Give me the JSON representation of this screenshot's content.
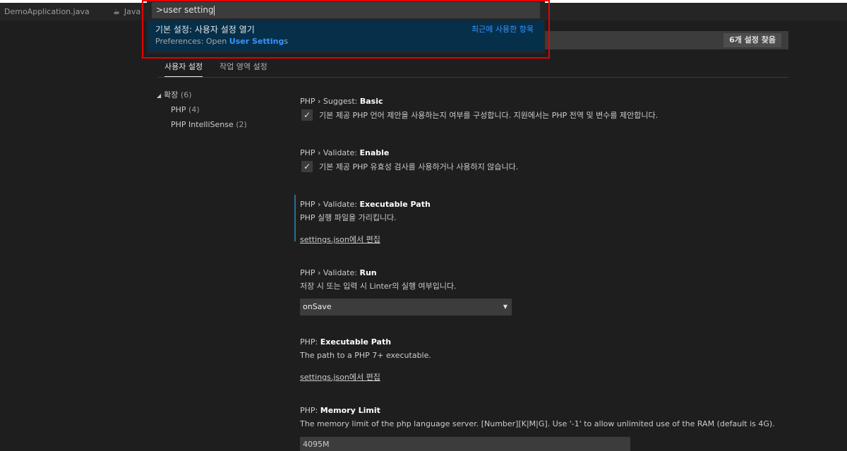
{
  "tabs": [
    {
      "label": "DemoApplication.java",
      "icon": "java-file-icon"
    },
    {
      "label": "Java",
      "icon": "coffee-icon"
    }
  ],
  "quick_input": {
    "value": ">user setting",
    "item": {
      "label": "기본 설정: 사용자 설정 열기",
      "recent": "최근에 사용한 항목",
      "detail_prefix": "Preferences: Open ",
      "detail_highlight": "User Setting",
      "detail_suffix": "s"
    },
    "highlight_color": "#e60000"
  },
  "settings_search": {
    "result_badge": "6개 설정 찾음"
  },
  "settings_tabs": {
    "user": "사용자 설정",
    "workspace": "작업 영역 설정"
  },
  "tree": {
    "root": {
      "label": "확장",
      "count": "(6)"
    },
    "children": [
      {
        "label": "PHP",
        "count": "(4)"
      },
      {
        "label": "PHP IntelliSense",
        "count": "(2)"
      }
    ]
  },
  "settings": {
    "suggest_basic": {
      "prefix": "PHP › Suggest: ",
      "name": "Basic",
      "description": "기본 제공 PHP 언어 제안을 사용하는지 여부를 구성합니다. 지원에서는 PHP 전역 및 변수를 제안합니다.",
      "checked": "✓"
    },
    "validate_enable": {
      "prefix": "PHP › Validate: ",
      "name": "Enable",
      "description": "기본 제공 PHP 유효성 검사를 사용하거나 사용하지 않습니다.",
      "checked": "✓"
    },
    "validate_exec_path": {
      "prefix": "PHP › Validate: ",
      "name": "Executable Path",
      "description": "PHP 실행 파일을 가리킵니다.",
      "link": "settings.json에서 편집"
    },
    "validate_run": {
      "prefix": "PHP › Validate: ",
      "name": "Run",
      "description": "저장 시 또는 입력 시 Linter의 실행 여부입니다.",
      "value": "onSave"
    },
    "exec_path": {
      "prefix": "PHP: ",
      "name": "Executable Path",
      "description": "The path to a PHP 7+ executable.",
      "link": "settings.json에서 편집"
    },
    "memory_limit": {
      "prefix": "PHP: ",
      "name": "Memory Limit",
      "description": "The memory limit of the php language server. [Number][K|M|G]. Use '-1' to allow unlimited use of the RAM (default is 4G).",
      "value": "4095M"
    }
  },
  "colors": {
    "accent": "#3794ff",
    "selection": "#062f4a",
    "background": "#1e1e1e"
  }
}
